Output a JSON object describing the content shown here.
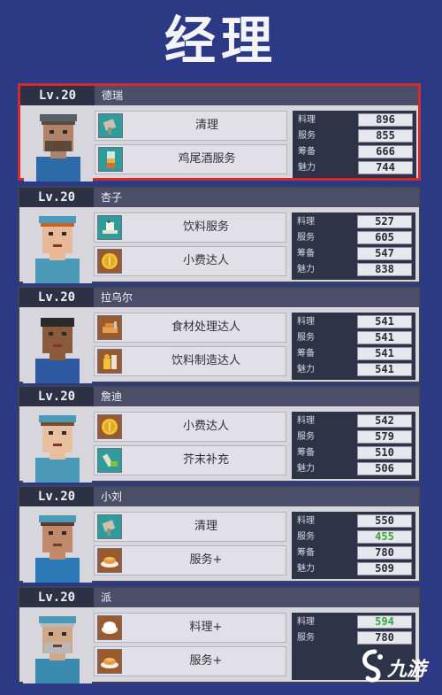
{
  "title": "经理",
  "cards": [
    {
      "level": "Lv.20",
      "name": "德瑞",
      "selected": true,
      "skills": [
        {
          "label": "清理",
          "icon": "cleaning-cloth-icon",
          "color": "teal"
        },
        {
          "label": "鸡尾酒服务",
          "icon": "cocktail-glass-icon",
          "color": "teal"
        }
      ],
      "stats": [
        {
          "label": "料理",
          "value": "896"
        },
        {
          "label": "服务",
          "value": "855"
        },
        {
          "label": "筹备",
          "value": "666"
        },
        {
          "label": "魅力",
          "value": "744"
        }
      ]
    },
    {
      "level": "Lv.20",
      "name": "杏子",
      "selected": false,
      "skills": [
        {
          "label": "饮料服务",
          "icon": "drink-tray-icon",
          "color": "teal"
        },
        {
          "label": "小费达人",
          "icon": "coin-icon",
          "color": "brown"
        }
      ],
      "stats": [
        {
          "label": "料理",
          "value": "527"
        },
        {
          "label": "服务",
          "value": "605"
        },
        {
          "label": "筹备",
          "value": "547"
        },
        {
          "label": "魅力",
          "value": "838"
        }
      ]
    },
    {
      "level": "Lv.20",
      "name": "拉乌尔",
      "selected": false,
      "skills": [
        {
          "label": "食材处理达人",
          "icon": "ingredient-prep-icon",
          "color": "brown"
        },
        {
          "label": "饮料制造达人",
          "icon": "drink-making-icon",
          "color": "brown"
        }
      ],
      "stats": [
        {
          "label": "料理",
          "value": "541"
        },
        {
          "label": "服务",
          "value": "541"
        },
        {
          "label": "筹备",
          "value": "541"
        },
        {
          "label": "魅力",
          "value": "541"
        }
      ]
    },
    {
      "level": "Lv.20",
      "name": "詹迪",
      "selected": false,
      "skills": [
        {
          "label": "小费达人",
          "icon": "coin-icon",
          "color": "brown"
        },
        {
          "label": "芥末补充",
          "icon": "mustard-refill-icon",
          "color": "teal"
        }
      ],
      "stats": [
        {
          "label": "料理",
          "value": "542"
        },
        {
          "label": "服务",
          "value": "579"
        },
        {
          "label": "筹备",
          "value": "510"
        },
        {
          "label": "魅力",
          "value": "506"
        }
      ]
    },
    {
      "level": "Lv.20",
      "name": "小刘",
      "selected": false,
      "skills": [
        {
          "label": "清理",
          "icon": "cleaning-cloth-icon",
          "color": "teal"
        },
        {
          "label": "服务+",
          "icon": "dish-plate-icon",
          "color": "brown"
        }
      ],
      "stats": [
        {
          "label": "料理",
          "value": "550"
        },
        {
          "label": "服务",
          "value": "455",
          "highlight": true
        },
        {
          "label": "筹备",
          "value": "780"
        },
        {
          "label": "魅力",
          "value": "509"
        }
      ]
    },
    {
      "level": "Lv.20",
      "name": "派",
      "selected": false,
      "skills": [
        {
          "label": "料理+",
          "icon": "rice-bowl-icon",
          "color": "brown"
        },
        {
          "label": "服务+",
          "icon": "dish-plate-icon",
          "color": "brown"
        }
      ],
      "stats": [
        {
          "label": "料理",
          "value": "594",
          "highlight": true
        },
        {
          "label": "服务",
          "value": "780"
        }
      ]
    }
  ],
  "watermark": {
    "text": "九游",
    "icon": "jiuyou-logo-icon"
  },
  "colors": {
    "background": "#2c3a86",
    "selected_border": "#d42a2a",
    "highlight_value": "#3aa63a"
  }
}
